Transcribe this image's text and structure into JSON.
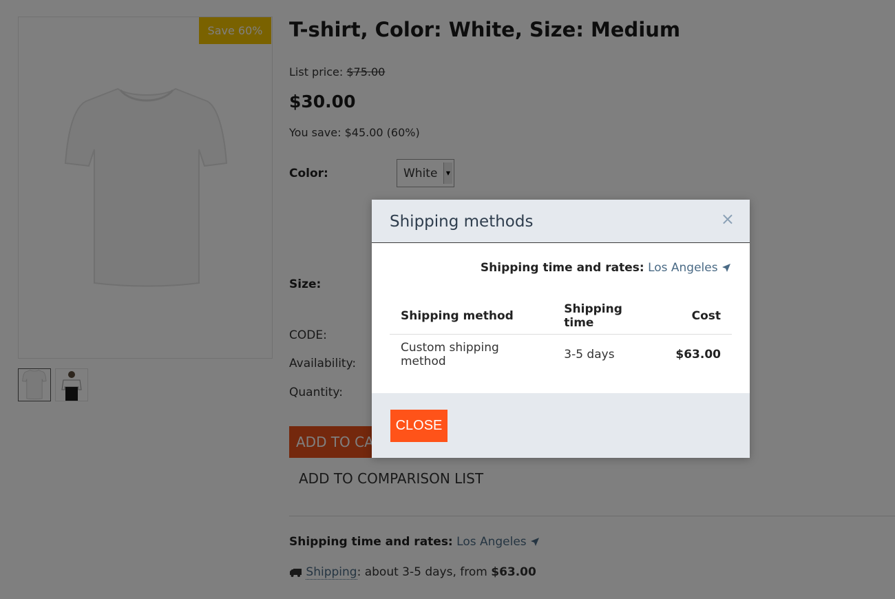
{
  "product": {
    "title": "T-shirt, Color: White, Size: Medium",
    "save_badge": "Save 60%",
    "list_price_label": "List price:",
    "list_price": "$75.00",
    "price": "$30.00",
    "you_save": "You save: $45.00 (60%)",
    "color_label": "Color:",
    "color_value": "White",
    "size_label": "Size:",
    "code_label": "CODE:",
    "availability_label": "Availability:",
    "quantity_label": "Quantity:",
    "add_to_cart": "ADD TO CART",
    "add_to_comparison": "ADD TO COMPARISON LIST",
    "shipping_rates_label": "Shipping time and rates:",
    "shipping_location": "Los Angeles",
    "shipping_link": "Shipping",
    "shipping_text": ": about 3-5 days, from ",
    "shipping_from_price": "$63.00"
  },
  "modal": {
    "title": "Shipping methods",
    "close_icon": "×",
    "rates_label": "Shipping time and rates:",
    "location": "Los Angeles",
    "table": {
      "headers": [
        "Shipping method",
        "Shipping time",
        "Cost"
      ],
      "rows": [
        [
          "Custom shipping method",
          "3-5 days",
          "$63.00"
        ]
      ]
    },
    "close_button": "CLOSE"
  },
  "colors": {
    "accent": "#ff5319",
    "badge": "#f5c400",
    "link": "#4a6a85"
  },
  "icons": {
    "location": "location-arrow-icon",
    "truck": "truck-icon",
    "close": "close-icon"
  }
}
